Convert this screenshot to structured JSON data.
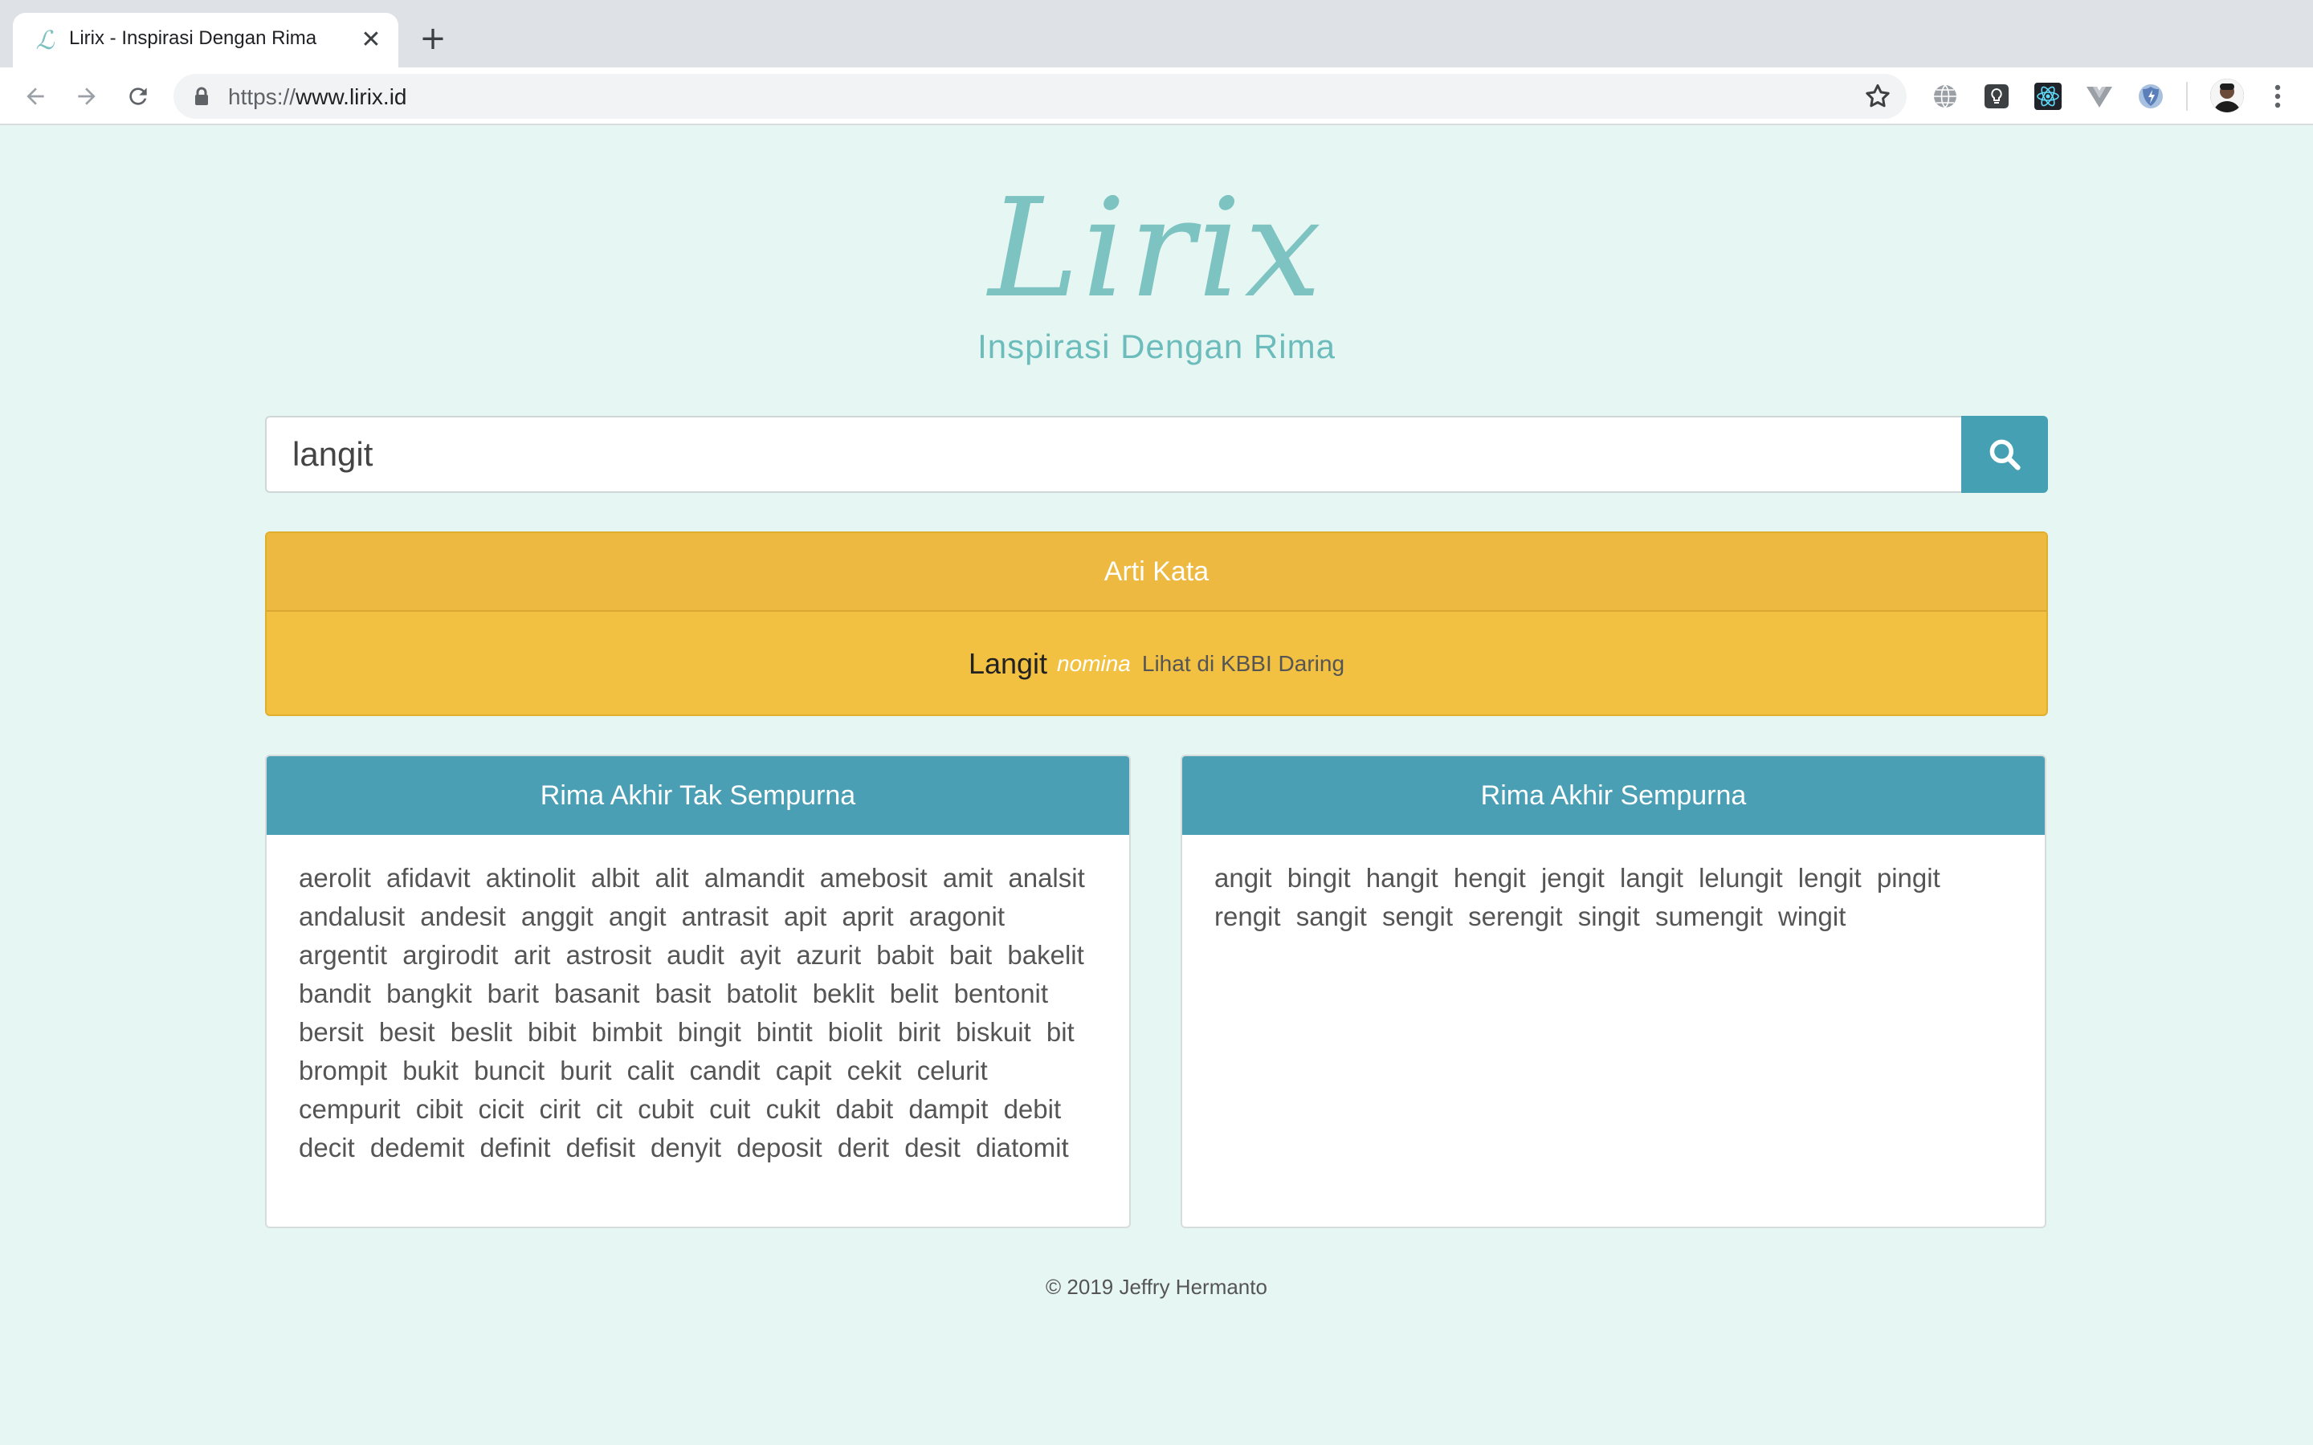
{
  "browser": {
    "tab_title": "Lirix - Inspirasi Dengan Rima",
    "tab_favicon": "ℒ",
    "url_scheme": "https://",
    "url_host": "www.lirix.id",
    "extensions": [
      "globe-icon",
      "lightbulb-icon",
      "react-icon",
      "vue-icon",
      "shield-icon"
    ]
  },
  "header": {
    "logo": "Lirix",
    "tagline": "Inspirasi Dengan Rima"
  },
  "search": {
    "value": "langit"
  },
  "meaning": {
    "title": "Arti Kata",
    "word": "Langit",
    "part_of_speech": "nomina",
    "link": "Lihat di KBBI Daring"
  },
  "imperfect_rhyme": {
    "title": "Rima Akhir Tak Sempurna",
    "words": "aerolit afidavit aktinolit albit alit almandit amebosit amit analsit andalusit andesit anggit angit antrasit apit aprit aragonit argentit argirodit arit astrosit audit ayit azurit babit bait bakelit bandit bangkit barit basanit basit batolit beklit belit bentonit bersit besit beslit bibit bimbit bingit bintit biolit birit biskuit bit brompit bukit buncit burit calit candit capit cekit celurit cempurit cibit cicit cirit cit cubit cuit cukit dabit dampit debit decit dedemit definit defisit denyit deposit derit desit diatomit"
  },
  "perfect_rhyme": {
    "title": "Rima Akhir Sempurna",
    "words": "angit bingit hangit hengit jengit langit lelungit lengit pingit rengit sangit sengit serengit singit sumengit wingit"
  },
  "footer": {
    "copyright": "© 2019 Jeffry Hermanto"
  },
  "colors": {
    "page_bg": "#e6f6f3",
    "logo": "#7cc3c1",
    "search_button": "#45a0b4",
    "meaning_card": "#f3c142",
    "rhyme_header": "#4a9fb4"
  }
}
